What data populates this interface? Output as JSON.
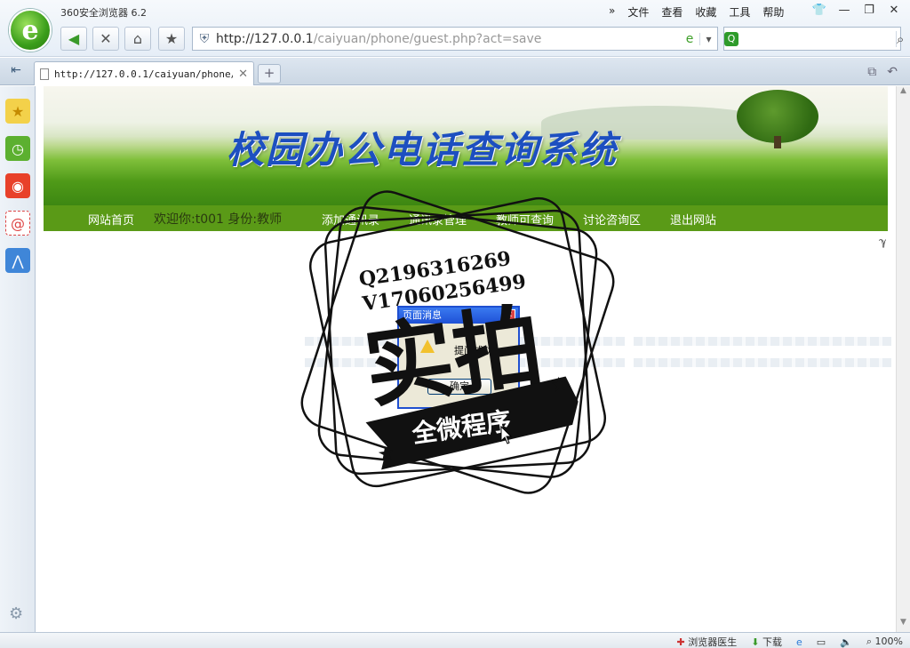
{
  "window": {
    "app_title": "360安全浏览器 6.2",
    "menu": [
      "文件",
      "查看",
      "收藏",
      "工具",
      "帮助"
    ]
  },
  "toolbar": {
    "url_host": "http://127.0.0.1",
    "url_path": "/caiyuan/phone/guest.php?act=save",
    "search_placeholder": ""
  },
  "tabs": [
    {
      "label": "http://127.0.0.1/caiyuan/phone/gu"
    }
  ],
  "page": {
    "banner_title": "校园办公电话查询系统",
    "nav": {
      "home": "网站首页",
      "welcome": "欢迎你:t001 身份:教师",
      "add": "添加通讯录",
      "manage": "通讯录管理",
      "teacher_query": "教师可查询",
      "discuss": "讨论咨询区",
      "logout": "退出网站"
    },
    "close_mark": "ℽ"
  },
  "dialog": {
    "title": "页面消息",
    "message": "提问成功",
    "ok_label": "确定"
  },
  "watermark": {
    "line1": "Q2196316269",
    "line2": "V17060256499",
    "main": "实拍",
    "banner": "全微程序"
  },
  "statusbar": {
    "doctor": "浏览器医生",
    "download": "下载",
    "zoom": "100%"
  },
  "colors": {
    "nav_green": "#5a9a17",
    "dialog_blue": "#1f4fd0",
    "banner_title_blue": "#1d4fc0"
  }
}
